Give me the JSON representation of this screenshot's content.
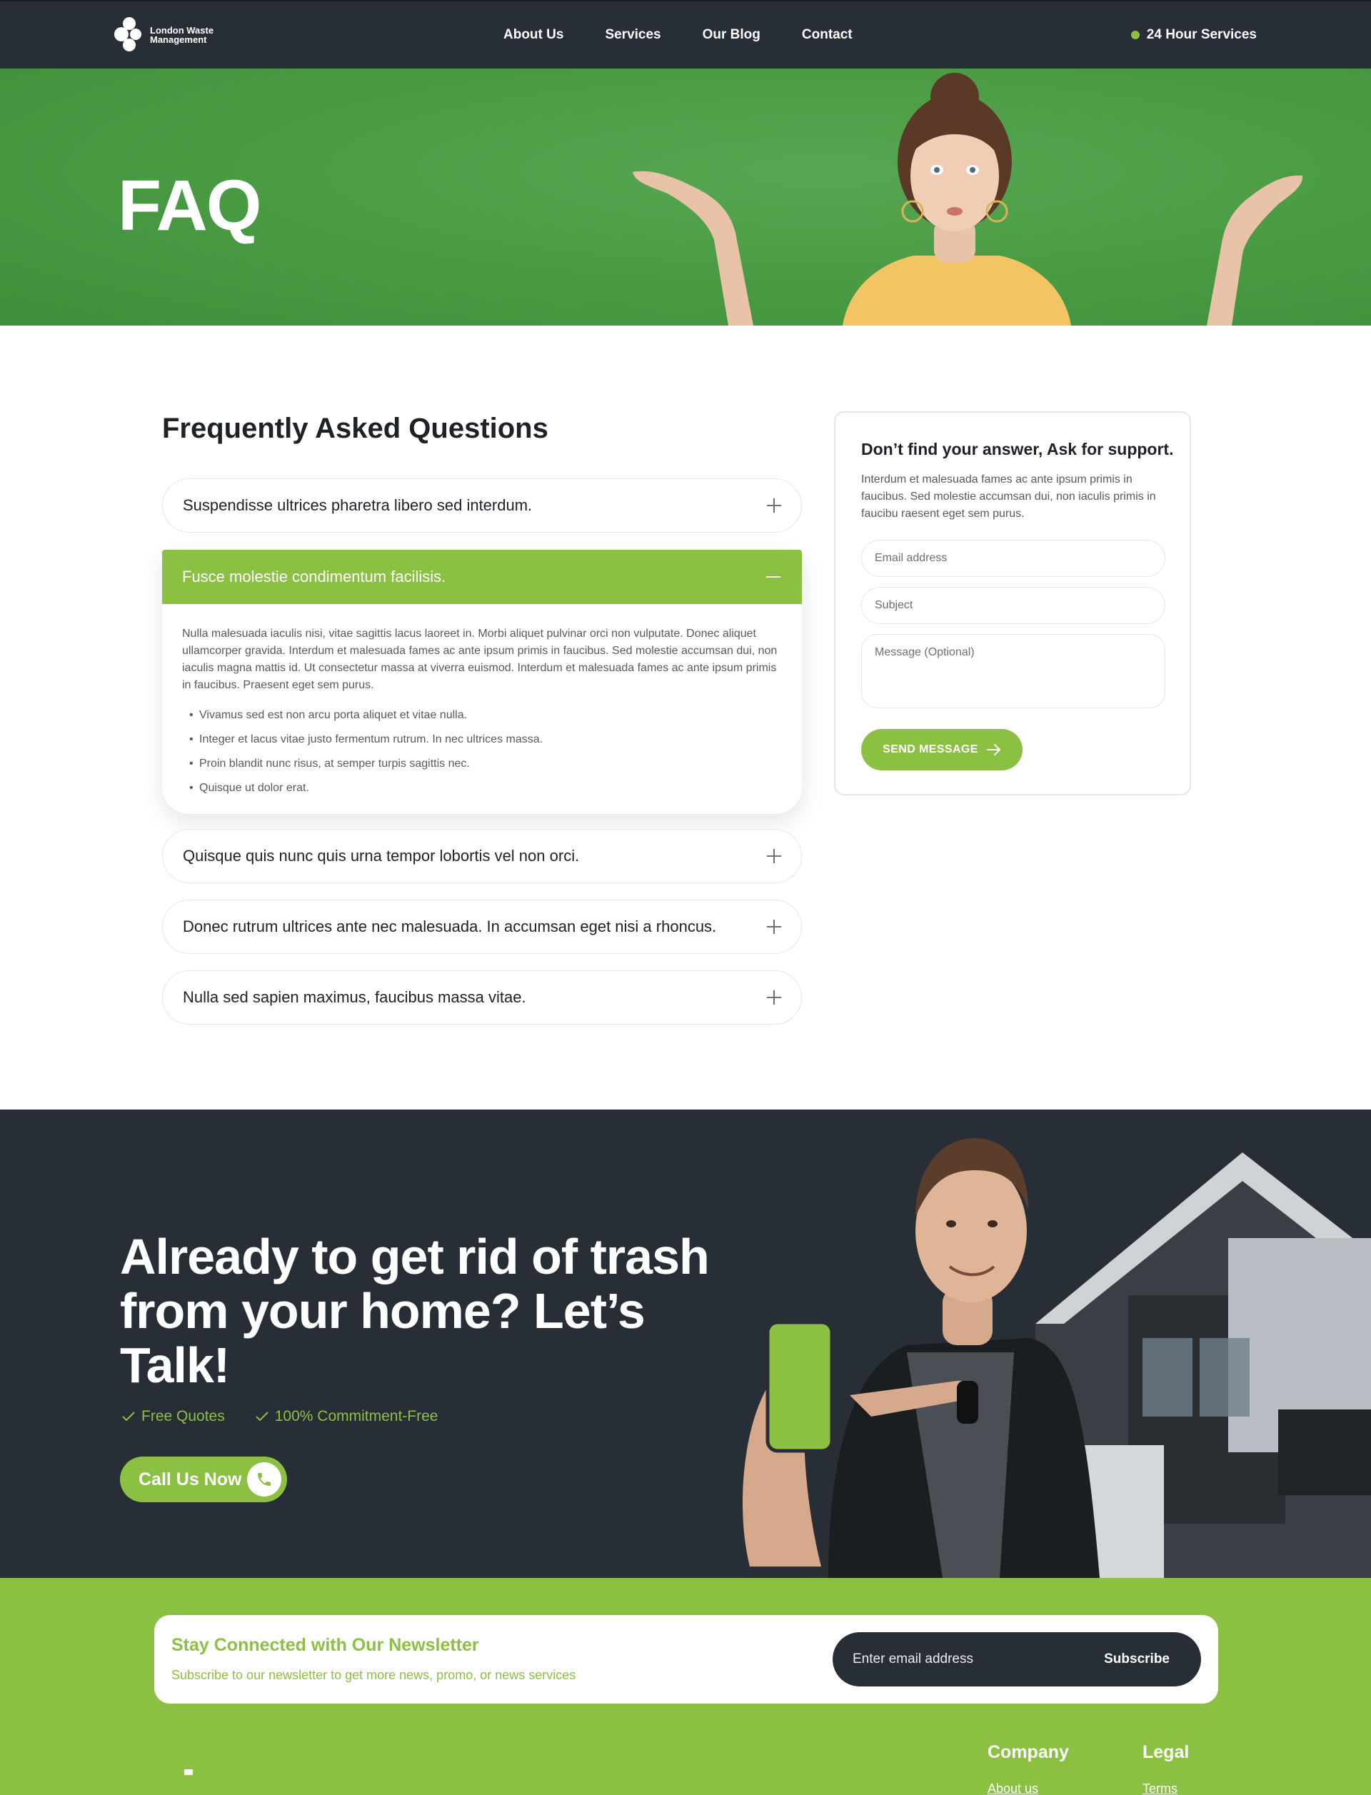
{
  "brand": {
    "name_line1": "London Waste",
    "name_line2": "Management"
  },
  "nav": {
    "links": [
      "About Us",
      "Services",
      "Our Blog",
      "Contact"
    ],
    "service_label": "24 Hour Services"
  },
  "hero": {
    "title": "FAQ"
  },
  "faq": {
    "title": "Frequently Asked Questions",
    "items": [
      {
        "question": "Suspendisse ultrices pharetra libero sed interdum."
      },
      {
        "question": "Fusce molestie condimentum facilisis.",
        "answer": "Nulla malesuada iaculis nisi, vitae sagittis lacus laoreet in. Morbi aliquet pulvinar orci non vulputate. Donec aliquet ullamcorper gravida. Interdum et malesuada fames ac ante ipsum primis in faucibus. Sed molestie accumsan dui, non iaculis magna mattis id. Ut consectetur massa at viverra euismod. Interdum et malesuada fames ac ante ipsum primis in faucibus. Praesent eget sem purus.",
        "bullets": [
          "Vivamus sed est non arcu porta aliquet et vitae nulla.",
          "Integer et lacus vitae justo fermentum rutrum. In nec ultrices massa.",
          "Proin blandit nunc risus, at semper turpis sagittis nec.",
          "Quisque ut dolor erat."
        ]
      },
      {
        "question": "Quisque quis nunc quis urna tempor lobortis vel non orci."
      },
      {
        "question": "Donec rutrum ultrices ante nec malesuada. In accumsan eget nisi a rhoncus."
      },
      {
        "question": "Nulla sed sapien maximus, faucibus massa vitae."
      }
    ]
  },
  "support": {
    "title": "Don’t find your answer, Ask for support.",
    "text": "Interdum et malesuada fames ac ante ipsum primis in faucibus. Sed molestie accumsan dui, non iaculis primis in faucibu raesent eget sem purus.",
    "email_placeholder": "Email address",
    "subject_placeholder": "Subject",
    "message_placeholder": "Message (Optional)",
    "send_label": "SEND MESSAGE"
  },
  "cta": {
    "title": "Already to get rid of trash from your home? Let’s Talk!",
    "checks": [
      "Free Quotes",
      "100% Commitment-Free"
    ],
    "call_label": "Call Us Now"
  },
  "newsletter": {
    "title": "Stay Connected with Our Newsletter",
    "subtitle": "Subscribe to our newsletter to get more news, promo, or news services",
    "placeholder": "Enter email address",
    "button": "Subscribe"
  },
  "footer": {
    "columns": [
      {
        "title": "Company",
        "first_link": "About us"
      },
      {
        "title": "Legal",
        "first_link": "Terms"
      }
    ]
  },
  "colors": {
    "accent": "#8cc043",
    "dark": "#282e35",
    "hero_green": "#4c9c46"
  }
}
